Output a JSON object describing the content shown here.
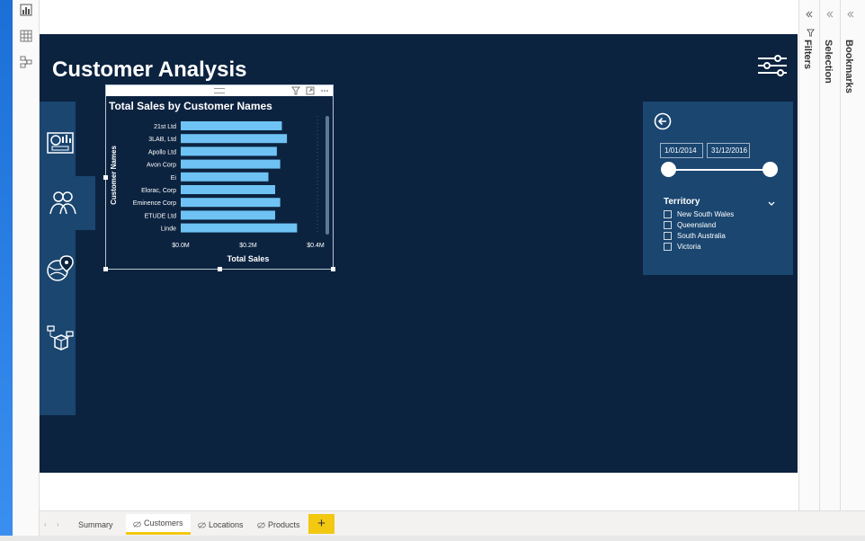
{
  "report": {
    "title": "Customer Analysis"
  },
  "nav_icons": [
    "dashboard-icon",
    "customers-icon",
    "locations-icon",
    "products-icon"
  ],
  "visual": {
    "title": "Total Sales by Customer Names"
  },
  "chart_data": {
    "type": "bar",
    "orientation": "horizontal",
    "title": "Total Sales by Customer Names",
    "xlabel": "Total Sales",
    "ylabel": "Customer Names",
    "categories": [
      "21st Ltd",
      "3LAB, Ltd",
      "Apollo Ltd",
      "Avon Corp",
      "Ei",
      "Elorac, Corp",
      "Eminence Corp",
      "ETUDE Ltd",
      "Linde"
    ],
    "values": [
      0.3,
      0.315,
      0.285,
      0.295,
      0.26,
      0.28,
      0.295,
      0.28,
      0.345
    ],
    "unit": "M",
    "x_ticks": [
      "$0.0M",
      "$0.2M",
      "$0.4M"
    ],
    "xlim": [
      0,
      0.4
    ],
    "bar_color": "#6ec3f4",
    "grid": false
  },
  "slicer": {
    "start_date": "1/01/2014",
    "end_date": "31/12/2016",
    "territory_label": "Territory",
    "territories": [
      "New South Wales",
      "Queensland",
      "South Australia",
      "Victoria"
    ]
  },
  "panes": {
    "filters": "Filters",
    "selection": "Selection",
    "bookmarks": "Bookmarks"
  },
  "tabs": [
    {
      "label": "Summary",
      "active": false,
      "hidden": false
    },
    {
      "label": "Customers",
      "active": true,
      "hidden": true
    },
    {
      "label": "Locations",
      "active": false,
      "hidden": true
    },
    {
      "label": "Products",
      "active": false,
      "hidden": true
    }
  ],
  "add_tab_label": "+",
  "colors": {
    "report_bg": "#0c2340",
    "panel_bg": "#1a4670",
    "bar": "#6ec3f4",
    "accent": "#f2c811"
  }
}
